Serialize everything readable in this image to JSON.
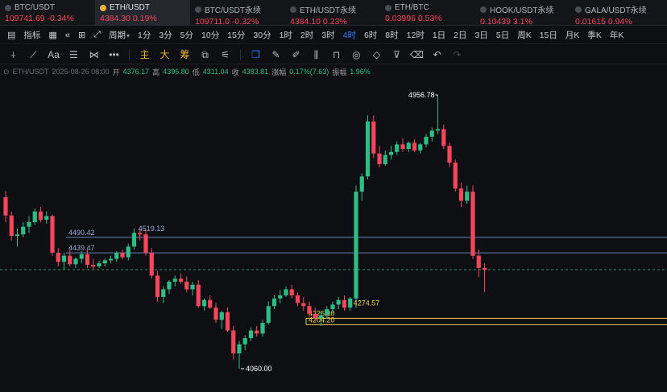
{
  "tickers": [
    {
      "name": "BTC/USDT",
      "price": "109741.69",
      "change": "-0.34%",
      "active": false
    },
    {
      "name": "ETH/USDT",
      "price": "4384.30",
      "change": "0.19%",
      "active": true
    },
    {
      "name": "BTC/USDT永续",
      "price": "109711.0",
      "change": "-0.32%",
      "active": false
    },
    {
      "name": "ETH/USDT永续",
      "price": "4384.10",
      "change": "0.23%",
      "active": false
    },
    {
      "name": "ETH/BTC",
      "price": "0.03996",
      "change": "0.53%",
      "active": false
    },
    {
      "name": "HOOK/USDT永续",
      "price": "0.10439",
      "change": "3.1%",
      "active": false
    },
    {
      "name": "GALA/USDT永续",
      "price": "0.01615",
      "change": "0.94%",
      "active": false
    }
  ],
  "toolbar": {
    "indicator_label": "指标",
    "period_label": "周期",
    "intervals": [
      "1分",
      "3分",
      "5分",
      "10分",
      "15分",
      "30分",
      "1时",
      "2时",
      "3时",
      "4时",
      "6时",
      "8时",
      "12时",
      "1日",
      "2日",
      "3日",
      "5日",
      "周K",
      "15日",
      "月K",
      "季K",
      "年K"
    ],
    "active_interval": "4时"
  },
  "drawing_tools": {
    "cn_labels": [
      "主",
      "大",
      "筹"
    ]
  },
  "ohlc_bar": {
    "symbol": "ETH/USDT",
    "time": "2025-08-26 08:00",
    "open_label": "开",
    "open": "4376.17",
    "high_label": "高",
    "high": "4396.80",
    "low_label": "低",
    "low": "4311.04",
    "close_label": "收",
    "close": "4383.81",
    "change_label": "涨幅",
    "change": "0.17%(7.63)",
    "amp_label": "振幅",
    "amp": "1.96%"
  },
  "colors": {
    "up": "#2ebd85",
    "down": "#f6465d",
    "accent": "#2f7bff",
    "support_line": "#e8d34a",
    "resistance_line": "#6f7fb8"
  },
  "chart_data": {
    "type": "candlestick",
    "ylim": [
      4000,
      5000
    ],
    "price_lines": [
      {
        "label": "4490.42",
        "price": 4490.42,
        "color": "#6f7fb8"
      },
      {
        "label": "4439.47",
        "price": 4439.47,
        "color": "#6f7fb8"
      },
      {
        "label": "4225.30",
        "price": 4225.3,
        "color": "#e8d34a"
      },
      {
        "label": "4204.20",
        "price": 4204.2,
        "color": "#e8d34a"
      }
    ],
    "annotations": [
      {
        "label": "4956.78",
        "price": 4956.78,
        "candle": 74
      },
      {
        "label": "4519.13",
        "price": 4519.13,
        "candle": 23
      },
      {
        "label": "4060.00",
        "price": 4060.0,
        "candle": 40
      },
      {
        "label": "4274.57",
        "price": 4274.57,
        "candle": 59
      }
    ],
    "current_price": 4384.3,
    "candles": [
      [
        4622,
        4642,
        4540,
        4562
      ],
      [
        4562,
        4575,
        4480,
        4495
      ],
      [
        4495,
        4520,
        4460,
        4500
      ],
      [
        4500,
        4540,
        4490,
        4525
      ],
      [
        4525,
        4560,
        4505,
        4540
      ],
      [
        4540,
        4585,
        4530,
        4575
      ],
      [
        4575,
        4590,
        4540,
        4548
      ],
      [
        4548,
        4575,
        4535,
        4560
      ],
      [
        4560,
        4565,
        4430,
        4440
      ],
      [
        4440,
        4455,
        4395,
        4410
      ],
      [
        4410,
        4440,
        4385,
        4430
      ],
      [
        4430,
        4448,
        4395,
        4402
      ],
      [
        4402,
        4425,
        4390,
        4420
      ],
      [
        4420,
        4445,
        4405,
        4435
      ],
      [
        4435,
        4450,
        4390,
        4400
      ],
      [
        4400,
        4420,
        4385,
        4395
      ],
      [
        4395,
        4412,
        4390,
        4405
      ],
      [
        4405,
        4420,
        4395,
        4415
      ],
      [
        4415,
        4430,
        4405,
        4420
      ],
      [
        4420,
        4445,
        4410,
        4440
      ],
      [
        4440,
        4450,
        4418,
        4425
      ],
      [
        4425,
        4470,
        4415,
        4460
      ],
      [
        4460,
        4520,
        4450,
        4505
      ],
      [
        4505,
        4519,
        4480,
        4500
      ],
      [
        4500,
        4515,
        4430,
        4440
      ],
      [
        4440,
        4455,
        4355,
        4365
      ],
      [
        4365,
        4380,
        4280,
        4295
      ],
      [
        4295,
        4330,
        4275,
        4320
      ],
      [
        4320,
        4350,
        4305,
        4345
      ],
      [
        4345,
        4365,
        4330,
        4355
      ],
      [
        4355,
        4372,
        4338,
        4345
      ],
      [
        4345,
        4362,
        4310,
        4320
      ],
      [
        4320,
        4345,
        4300,
        4335
      ],
      [
        4335,
        4350,
        4260,
        4265
      ],
      [
        4265,
        4290,
        4250,
        4285
      ],
      [
        4285,
        4300,
        4255,
        4260
      ],
      [
        4260,
        4275,
        4210,
        4220
      ],
      [
        4220,
        4250,
        4190,
        4245
      ],
      [
        4245,
        4260,
        4180,
        4185
      ],
      [
        4185,
        4200,
        4090,
        4110
      ],
      [
        4110,
        4150,
        4060,
        4140
      ],
      [
        4140,
        4170,
        4120,
        4160
      ],
      [
        4160,
        4195,
        4150,
        4185
      ],
      [
        4185,
        4200,
        4165,
        4175
      ],
      [
        4175,
        4220,
        4165,
        4210
      ],
      [
        4210,
        4280,
        4205,
        4265
      ],
      [
        4265,
        4300,
        4255,
        4290
      ],
      [
        4290,
        4318,
        4275,
        4300
      ],
      [
        4300,
        4330,
        4295,
        4320
      ],
      [
        4320,
        4335,
        4290,
        4300
      ],
      [
        4300,
        4310,
        4265,
        4275
      ],
      [
        4275,
        4295,
        4250,
        4265
      ],
      [
        4265,
        4280,
        4230,
        4240
      ],
      [
        4240,
        4260,
        4215,
        4225
      ],
      [
        4225,
        4245,
        4200,
        4235
      ],
      [
        4235,
        4265,
        4225,
        4255
      ],
      [
        4255,
        4280,
        4240,
        4270
      ],
      [
        4270,
        4295,
        4255,
        4285
      ],
      [
        4285,
        4300,
        4250,
        4260
      ],
      [
        4260,
        4295,
        4250,
        4290
      ],
      [
        4290,
        4660,
        4260,
        4640
      ],
      [
        4640,
        4700,
        4610,
        4690
      ],
      [
        4690,
        4890,
        4680,
        4870
      ],
      [
        4870,
        4890,
        4750,
        4765
      ],
      [
        4765,
        4790,
        4720,
        4730
      ],
      [
        4730,
        4775,
        4725,
        4760
      ],
      [
        4760,
        4790,
        4745,
        4770
      ],
      [
        4770,
        4805,
        4760,
        4795
      ],
      [
        4795,
        4815,
        4770,
        4780
      ],
      [
        4780,
        4805,
        4770,
        4800
      ],
      [
        4800,
        4812,
        4770,
        4775
      ],
      [
        4775,
        4800,
        4765,
        4795
      ],
      [
        4795,
        4830,
        4785,
        4820
      ],
      [
        4820,
        4850,
        4805,
        4840
      ],
      [
        4840,
        4956.78,
        4830,
        4845
      ],
      [
        4845,
        4860,
        4780,
        4790
      ],
      [
        4790,
        4800,
        4720,
        4735
      ],
      [
        4735,
        4745,
        4640,
        4650
      ],
      [
        4650,
        4670,
        4590,
        4610
      ],
      [
        4610,
        4660,
        4600,
        4640
      ],
      [
        4640,
        4660,
        4420,
        4430
      ],
      [
        4430,
        4450,
        4360,
        4390
      ],
      [
        4390,
        4405,
        4311,
        4384
      ]
    ]
  }
}
